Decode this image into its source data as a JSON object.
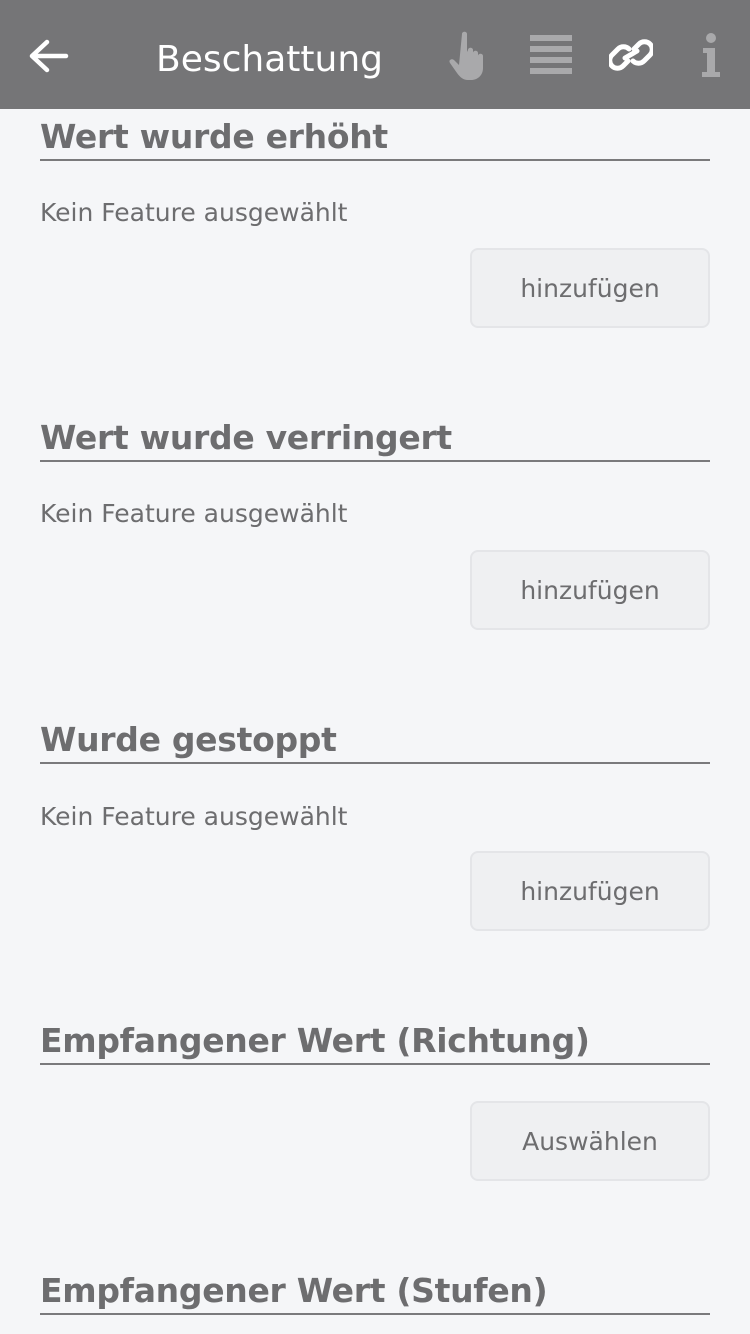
{
  "header": {
    "title": "Beschattung",
    "back_icon": "arrow-left-icon",
    "actions": [
      {
        "name": "hand-pointer-icon"
      },
      {
        "name": "list-lines-icon"
      },
      {
        "name": "link-icon"
      },
      {
        "name": "info-icon"
      }
    ],
    "colors": {
      "bar": "#757577",
      "icon_active": "#ffffff",
      "icon_muted": "#a9a9ab"
    }
  },
  "sections": [
    {
      "title": "Wert wurde erhöht",
      "empty_text": "Kein Feature ausgewählt",
      "button_label": "hinzufügen"
    },
    {
      "title": "Wert wurde verringert",
      "empty_text": "Kein Feature ausgewählt",
      "button_label": "hinzufügen"
    },
    {
      "title": "Wurde gestoppt",
      "empty_text": "Kein Feature ausgewählt",
      "button_label": "hinzufügen"
    },
    {
      "title": "Empfangener Wert (Richtung)",
      "button_label": "Auswählen"
    },
    {
      "title": "Empfangener Wert (Stufen)"
    }
  ]
}
